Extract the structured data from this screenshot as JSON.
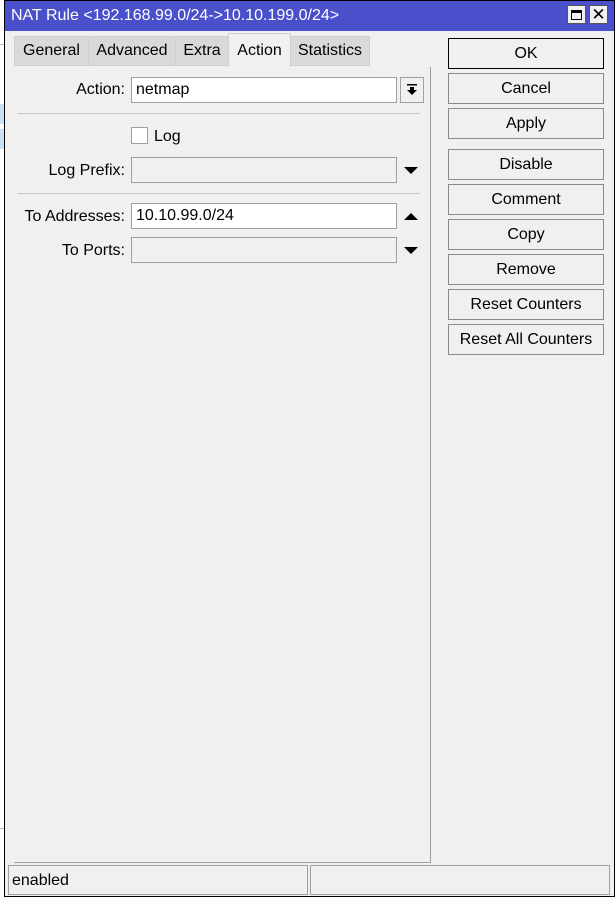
{
  "window": {
    "title": "NAT Rule <192.168.99.0/24->10.10.199.0/24>",
    "maximize_icon": "maximize-icon",
    "close_icon": "close-icon",
    "close_glyph": "✕"
  },
  "tabs": [
    {
      "label": "General",
      "active": false
    },
    {
      "label": "Advanced",
      "active": false
    },
    {
      "label": "Extra",
      "active": false
    },
    {
      "label": "Action",
      "active": true
    },
    {
      "label": "Statistics",
      "active": false
    }
  ],
  "form": {
    "action": {
      "label": "Action:",
      "value": "netmap",
      "icon": "dropdown-icon"
    },
    "log": {
      "label": "Log",
      "checked": false
    },
    "log_prefix": {
      "label": "Log Prefix:",
      "value": "",
      "icon": "expand-down-icon"
    },
    "to_addresses": {
      "label": "To Addresses:",
      "value": "10.10.99.0/24",
      "icon": "collapse-up-icon"
    },
    "to_ports": {
      "label": "To Ports:",
      "value": "",
      "icon": "expand-down-icon"
    }
  },
  "buttons": {
    "ok": "OK",
    "cancel": "Cancel",
    "apply": "Apply",
    "disable": "Disable",
    "comment": "Comment",
    "copy": "Copy",
    "remove": "Remove",
    "reset_counters": "Reset Counters",
    "reset_all_counters": "Reset All Counters"
  },
  "status": {
    "state": "enabled",
    "secondary": ""
  }
}
